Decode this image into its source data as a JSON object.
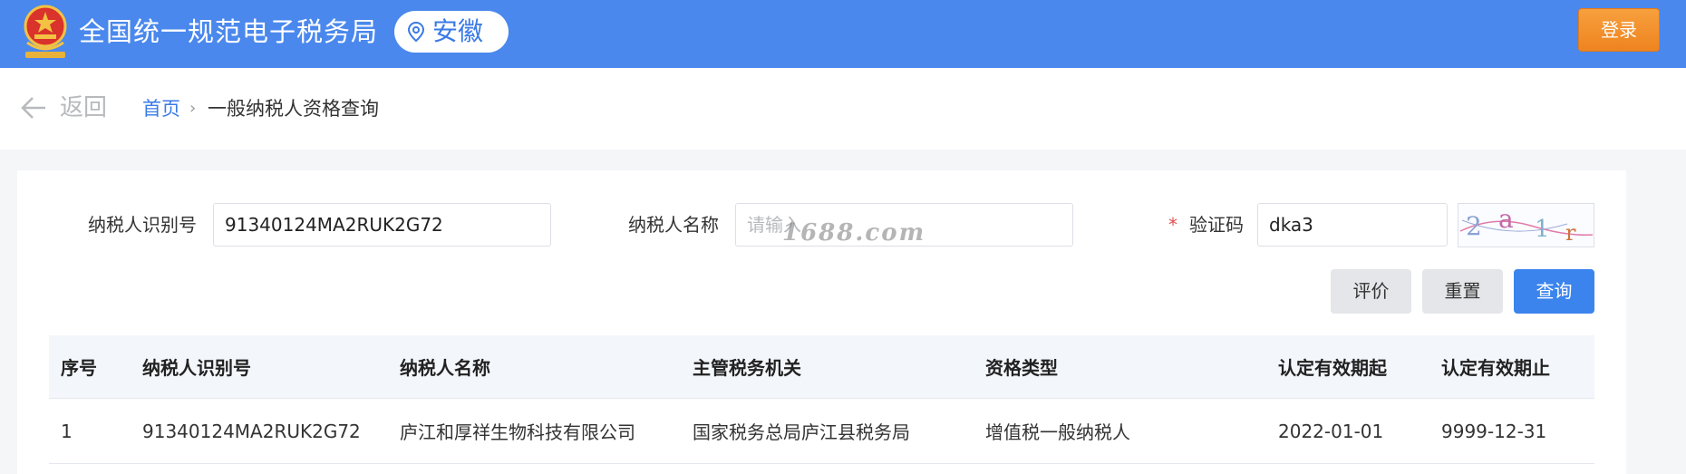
{
  "header": {
    "site_title": "全国统一规范电子税务局",
    "region": "安徽",
    "login_label": "登录",
    "emblem_icon": "national-emblem-icon",
    "brand_color": "#4a88ed"
  },
  "breadcrumb": {
    "back_label": "返回",
    "home_label": "首页",
    "separator": "›",
    "current_label": "一般纳税人资格查询"
  },
  "search_form": {
    "taxpayer_id_label": "纳税人识别号",
    "taxpayer_id_value": "91340124MA2RUK2G72",
    "taxpayer_name_label": "纳税人名称",
    "taxpayer_name_placeholder": "请输入",
    "captcha_label": "验证码",
    "captcha_required": "*",
    "captcha_value": "dka3",
    "captcha_image_text": "2a1r",
    "watermark": "1688.com"
  },
  "buttons": {
    "evaluate": "评价",
    "reset": "重置",
    "query": "查询"
  },
  "table": {
    "columns": [
      "序号",
      "纳税人识别号",
      "纳税人名称",
      "主管税务机关",
      "资格类型",
      "认定有效期起",
      "认定有效期止"
    ],
    "rows": [
      [
        "1",
        "91340124MA2RUK2G72",
        "庐江和厚祥生物科技有限公司",
        "国家税务总局庐江县税务局",
        "增值税一般纳税人",
        "2022-01-01",
        "9999-12-31"
      ]
    ]
  }
}
